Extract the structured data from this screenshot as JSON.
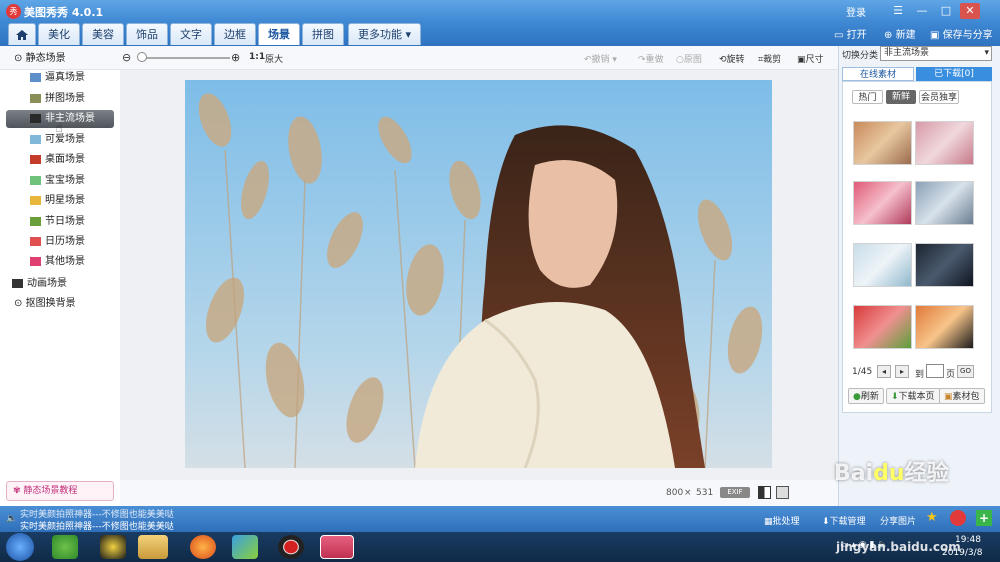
{
  "app": {
    "title": "美图秀秀 4.0.1",
    "logo_text": "秀",
    "login": "登录"
  },
  "window_controls": {
    "skin": "☰",
    "minimize": "—",
    "maximize": "□",
    "close": "✕"
  },
  "menu": {
    "home_icon": "home-icon",
    "tabs": [
      "美化",
      "美容",
      "饰品",
      "文字",
      "边框",
      "场景",
      "拼图",
      "更多功能"
    ],
    "active": "场景",
    "open": "打开",
    "new": "新建",
    "save": "保存与分享"
  },
  "toolbar": {
    "zoom_ratio": "1:1",
    "original": "原大",
    "undo": "撤销",
    "redo": "重做",
    "restore": "原图",
    "rotate": "旋转",
    "crop": "裁剪",
    "size": "尺寸"
  },
  "left_tree": {
    "static": "静态场景",
    "items": [
      "逼真场景",
      "拼图场景",
      "非主流场景",
      "可爱场景",
      "桌面场景",
      "宝宝场景",
      "明星场景",
      "节日场景",
      "日历场景",
      "其他场景"
    ],
    "selected": "非主流场景",
    "animated": "动画场景",
    "cutout": "抠图换背景",
    "tutorial": "静态场景教程"
  },
  "right_panel": {
    "category_label": "切换分类",
    "category_value": "非主流场景",
    "tab_online": "在线素材",
    "tab_downloaded": "已下载[0]",
    "subtabs": [
      "热门",
      "新鲜",
      "会员独享"
    ],
    "active_subtab": "新鲜",
    "page": "1/45",
    "goto_label": "到",
    "page_unit": "页",
    "go": "GO",
    "refresh": "刷新",
    "download_page": "下载本页",
    "pack": "素材包"
  },
  "image_info": {
    "width": "800",
    "times": "×",
    "height": "531",
    "exif": "EXIF"
  },
  "status": {
    "ticker_line1": "实时美颜拍照神器---不修图也能美美哒",
    "ticker_line2": "实时美颜拍照神器---不修图也能美美哒",
    "batch": "批处理",
    "download_mgr": "下载管理",
    "share": "分享图片"
  },
  "taskbar": {
    "time": "19:48",
    "date": "2019/3/8"
  },
  "watermark": "Baidu经验 jingyan.baidu.com"
}
